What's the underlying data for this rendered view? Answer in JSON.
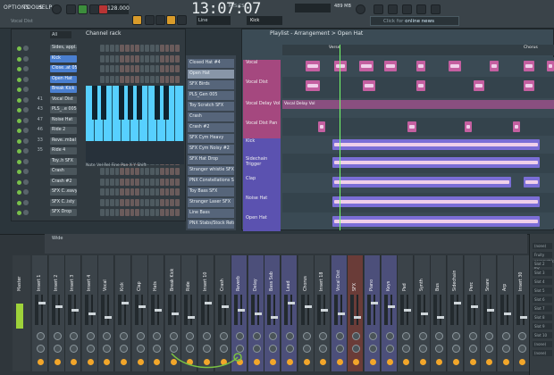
{
  "menu": {
    "items": [
      "OPTIONS",
      "TOOLS",
      "HELP"
    ],
    "vol_label": "Vocal Dist"
  },
  "transport": {
    "tempo": "128.000",
    "song_time": "13:07:07",
    "time_sub": "M:S:CS"
  },
  "toolbar": {
    "pattern": "Line",
    "channel": "Kick",
    "cpu": "489 MB",
    "news_prefix": "Click for ",
    "news_highlight": "online news"
  },
  "channel_rack": {
    "title": "Channel rack",
    "filter": "All",
    "channels": [
      {
        "num": "",
        "name": "Sides, appl..",
        "sel": false
      },
      {
        "num": "",
        "name": "Kick",
        "sel": true
      },
      {
        "num": "",
        "name": "Close..at 05",
        "sel": true
      },
      {
        "num": "",
        "name": "Open Hat",
        "sel": true
      },
      {
        "num": "",
        "name": "Break Kick",
        "sel": true
      },
      {
        "num": "41",
        "name": "Vocal Dist",
        "sel": false
      },
      {
        "num": "43",
        "name": "PLS_..e 005",
        "sel": false
      },
      {
        "num": "47",
        "name": "Noise Hat",
        "sel": false
      },
      {
        "num": "46",
        "name": "Ride 2",
        "sel": false
      },
      {
        "num": "33",
        "name": "Reve..mbal",
        "sel": false
      },
      {
        "num": "35",
        "name": "Ride 4",
        "sel": false
      },
      {
        "num": "",
        "name": "Toy..h SFX",
        "sel": false
      },
      {
        "num": "",
        "name": "Crash",
        "sel": false
      },
      {
        "num": "",
        "name": "Crash #2",
        "sel": false
      },
      {
        "num": "",
        "name": "SFX C..eavy",
        "sel": false
      },
      {
        "num": "",
        "name": "SFX C..isty",
        "sel": false
      },
      {
        "num": "",
        "name": "SFX Drop",
        "sel": false
      }
    ],
    "piano_tabs": "Note Vel Rel Fine Pan X Y Shift"
  },
  "playlist": {
    "title": "Playlist - Arrangement > Open Hat",
    "patterns": [
      "Closed Hat #4",
      "Open Hat",
      "SFX Birds",
      "PLS_Gen 005",
      "Toy Scratch SFX",
      "Crash",
      "Crash #2",
      "SFX Cym Heavy",
      "SFX Cym Noisy #2",
      "SFX Hat Drop",
      "Stranger whistle SFX",
      "PNX Constellations Sh..",
      "Toy Bass SFX",
      "Stranger Laser SFX",
      "Line Bass",
      "PNX Stabs/Stock Retro.."
    ],
    "tracks": [
      {
        "name": "Vocal"
      },
      {
        "name": "Vocal Dist"
      },
      {
        "name": "Vocal Delay Vol"
      },
      {
        "name": "Vocal Dist Pan"
      },
      {
        "name": "Kick"
      },
      {
        "name": "Sidechain Trigger"
      },
      {
        "name": "Clap"
      },
      {
        "name": "Noise Hat"
      },
      {
        "name": "Open Hat"
      }
    ],
    "long_clip": "Vocal Delay Vol",
    "markers": [
      "Verse",
      "Chorus"
    ]
  },
  "mixer": {
    "title": "Wide",
    "strips": [
      "Master",
      "Insert 1",
      "Insert 2",
      "Insert 3",
      "Insert 4",
      "Vocal",
      "Kick",
      "Clap",
      "Hats",
      "Break Kick",
      "Ride",
      "Insert 10",
      "Crash",
      "Reverb",
      "Delay",
      "Bass Sub",
      "Lead",
      "Chorus",
      "Insert 18",
      "Vocal Dist",
      "SFX",
      "Piano",
      "Keys",
      "Pad",
      "Synth",
      "Bus",
      "Sidechain",
      "Perc",
      "Snare",
      "Arp",
      "Insert 30"
    ],
    "right_panel": [
      "(none)",
      "Fruity parametric EQ",
      "Slot 2",
      "Slot 3",
      "Slot 4",
      "Slot 5",
      "Slot 6",
      "Slot 7",
      "Slot 8",
      "Slot 9",
      "Slot 10",
      "(none)",
      "(none)"
    ]
  }
}
